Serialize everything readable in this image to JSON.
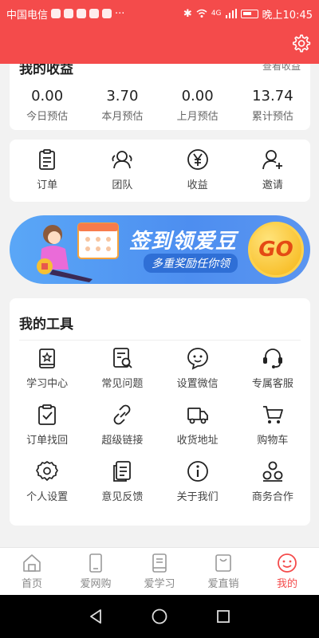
{
  "status_bar": {
    "carrier": "中国电信",
    "more": "···",
    "network": "4G",
    "time": "晚上10:45"
  },
  "header": {
    "settings_icon": "gear-icon"
  },
  "earnings": {
    "title": "我的收益",
    "link": "查看收益",
    "items": [
      {
        "value": "0.00",
        "label": "今日预估"
      },
      {
        "value": "3.70",
        "label": "本月预估"
      },
      {
        "value": "0.00",
        "label": "上月预估"
      },
      {
        "value": "13.74",
        "label": "累计预估"
      }
    ]
  },
  "quick_actions": [
    {
      "label": "订单",
      "icon": "clipboard-icon"
    },
    {
      "label": "团队",
      "icon": "team-icon"
    },
    {
      "label": "收益",
      "icon": "yen-icon"
    },
    {
      "label": "邀请",
      "icon": "add-user-icon"
    }
  ],
  "banner": {
    "title": "签到领爱豆",
    "subtitle": "多重奖励任你领",
    "button": "GO",
    "color": "#4d8ef0"
  },
  "tools": {
    "title": "我的工具",
    "items": [
      {
        "label": "学习中心",
        "icon": "book-star-icon"
      },
      {
        "label": "常见问题",
        "icon": "doc-search-icon"
      },
      {
        "label": "设置微信",
        "icon": "chat-bubble-icon"
      },
      {
        "label": "专属客服",
        "icon": "headset-icon"
      },
      {
        "label": "订单找回",
        "icon": "clipboard-check-icon"
      },
      {
        "label": "超级链接",
        "icon": "link-icon"
      },
      {
        "label": "收货地址",
        "icon": "truck-icon"
      },
      {
        "label": "购物车",
        "icon": "cart-icon"
      },
      {
        "label": "个人设置",
        "icon": "gear-icon"
      },
      {
        "label": "意见反馈",
        "icon": "feedback-icon"
      },
      {
        "label": "关于我们",
        "icon": "info-icon"
      },
      {
        "label": "商务合作",
        "icon": "cooperation-icon"
      }
    ]
  },
  "bottom_nav": [
    {
      "label": "首页",
      "icon": "home-icon"
    },
    {
      "label": "爱网购",
      "icon": "phone-icon"
    },
    {
      "label": "爱学习",
      "icon": "book-icon"
    },
    {
      "label": "爱直销",
      "icon": "bag-icon"
    },
    {
      "label": "我的",
      "icon": "smile-icon",
      "active": true
    }
  ],
  "colors": {
    "accent": "#f44b4b",
    "header": "#f44b4b"
  }
}
